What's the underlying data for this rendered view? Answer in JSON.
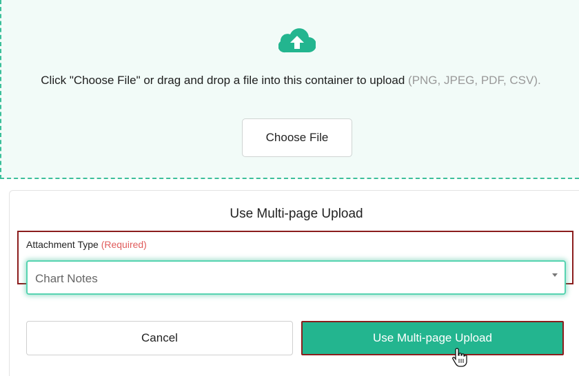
{
  "dropzone": {
    "instruction": "Click \"Choose File\" or drag and drop a file into this container to upload",
    "file_types": "(PNG, JPEG, PDF, CSV).",
    "choose_file_label": "Choose File",
    "icon": "cloud-upload-icon"
  },
  "panel": {
    "title": "Use Multi-page Upload",
    "attachment_type_label": "Attachment Type",
    "required_label": "(Required)",
    "attachment_type_value": "Chart Notes",
    "cancel_label": "Cancel",
    "upload_label": "Use Multi-page Upload"
  },
  "colors": {
    "accent": "#23b58f",
    "highlight": "#8b1c1c",
    "required": "#e05b5b"
  }
}
